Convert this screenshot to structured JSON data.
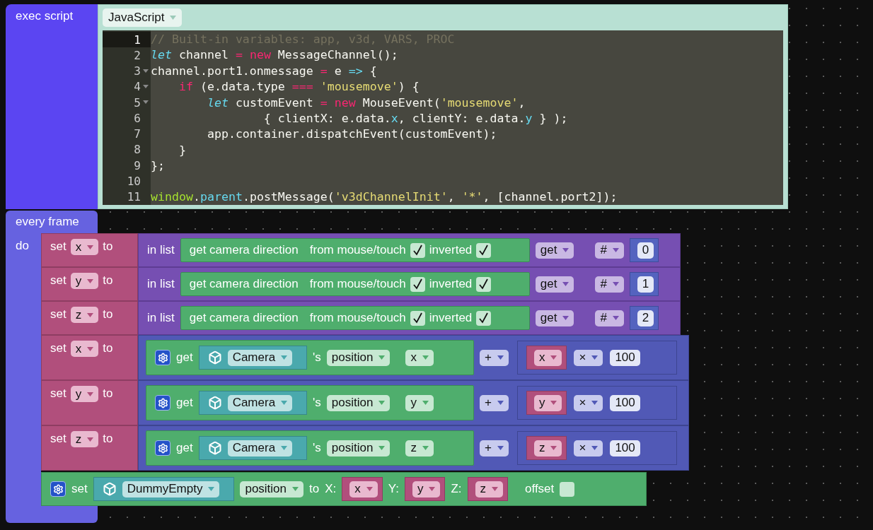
{
  "exec_block": {
    "label": "exec script",
    "language": "JavaScript",
    "code_lines": [
      {
        "number": "1",
        "active": true,
        "fold": false,
        "tokens": [
          {
            "kind": "comment",
            "text": "// Built-in variables: app, v3d, VARS, PROC"
          }
        ]
      },
      {
        "number": "2",
        "active": false,
        "fold": false,
        "tokens": [
          {
            "kind": "storage",
            "text": "let"
          },
          {
            "kind": "plain",
            "text": " channel "
          },
          {
            "kind": "operator",
            "text": "="
          },
          {
            "kind": "operator",
            "text": " new"
          },
          {
            "kind": "plain",
            "text": " MessageChannel();"
          }
        ]
      },
      {
        "number": "3",
        "active": false,
        "fold": true,
        "tokens": [
          {
            "kind": "plain",
            "text": "channel.port1.onmessage "
          },
          {
            "kind": "operator",
            "text": "="
          },
          {
            "kind": "plain",
            "text": " e "
          },
          {
            "kind": "property",
            "text": "=>"
          },
          {
            "kind": "plain",
            "text": " {"
          }
        ]
      },
      {
        "number": "4",
        "active": false,
        "fold": true,
        "tokens": [
          {
            "kind": "operator",
            "text": "    if"
          },
          {
            "kind": "plain",
            "text": " (e.data.type "
          },
          {
            "kind": "operator",
            "text": "==="
          },
          {
            "kind": "string",
            "text": " 'mousemove'"
          },
          {
            "kind": "plain",
            "text": ") {"
          }
        ]
      },
      {
        "number": "5",
        "active": false,
        "fold": true,
        "tokens": [
          {
            "kind": "storage",
            "text": "        let"
          },
          {
            "kind": "plain",
            "text": " customEvent "
          },
          {
            "kind": "operator",
            "text": "="
          },
          {
            "kind": "operator",
            "text": " new"
          },
          {
            "kind": "plain",
            "text": " MouseEvent("
          },
          {
            "kind": "string",
            "text": "'mousemove'"
          },
          {
            "kind": "plain",
            "text": ","
          }
        ]
      },
      {
        "number": "6",
        "active": false,
        "fold": false,
        "tokens": [
          {
            "kind": "plain",
            "text": "                { clientX: e.data."
          },
          {
            "kind": "property",
            "text": "x"
          },
          {
            "kind": "plain",
            "text": ", clientY: e.data."
          },
          {
            "kind": "property",
            "text": "y"
          },
          {
            "kind": "plain",
            "text": " } );"
          }
        ]
      },
      {
        "number": "7",
        "active": false,
        "fold": false,
        "tokens": [
          {
            "kind": "plain",
            "text": "        app.container.dispatchEvent(customEvent);"
          }
        ]
      },
      {
        "number": "8",
        "active": false,
        "fold": false,
        "tokens": [
          {
            "kind": "plain",
            "text": "    }"
          }
        ]
      },
      {
        "number": "9",
        "active": false,
        "fold": false,
        "tokens": [
          {
            "kind": "plain",
            "text": "};"
          }
        ]
      },
      {
        "number": "10",
        "active": false,
        "fold": false
      },
      {
        "number": "11",
        "active": false,
        "fold": false,
        "tokens": [
          {
            "kind": "global",
            "text": "window"
          },
          {
            "kind": "plain",
            "text": "."
          },
          {
            "kind": "property",
            "text": "parent"
          },
          {
            "kind": "plain",
            "text": ".postMessage("
          },
          {
            "kind": "string",
            "text": "'v3dChannelInit'"
          },
          {
            "kind": "plain",
            "text": ", "
          },
          {
            "kind": "string",
            "text": "'*'"
          },
          {
            "kind": "plain",
            "text": ", [channel.port2]);"
          }
        ]
      }
    ]
  },
  "every_frame": {
    "label": "every frame",
    "do_label": "do",
    "statements": [
      {
        "kind": "set_list",
        "set_label": "set",
        "variable": "x",
        "to_label": "to",
        "in_list_label": "in list",
        "getter": "get camera direction",
        "from_label": "from mouse/touch",
        "from_checked": true,
        "inverted_label": "inverted",
        "inverted_checked": true,
        "mode": "get",
        "index_mode": "#",
        "index": "0"
      },
      {
        "kind": "set_list",
        "set_label": "set",
        "variable": "y",
        "to_label": "to",
        "in_list_label": "in list",
        "getter": "get camera direction",
        "from_label": "from mouse/touch",
        "from_checked": true,
        "inverted_label": "inverted",
        "inverted_checked": true,
        "mode": "get",
        "index_mode": "#",
        "index": "1"
      },
      {
        "kind": "set_list",
        "set_label": "set",
        "variable": "z",
        "to_label": "to",
        "in_list_label": "in list",
        "getter": "get camera direction",
        "from_label": "from mouse/touch",
        "from_checked": true,
        "inverted_label": "inverted",
        "inverted_checked": true,
        "mode": "get",
        "index_mode": "#",
        "index": "2"
      },
      {
        "kind": "set_math",
        "set_label": "set",
        "variable": "x",
        "to_label": "to",
        "get_label": "get",
        "object": "Camera",
        "of_label": "'s",
        "property": "position",
        "axis": "x",
        "operator": "+",
        "operand_variable": "x",
        "multiply": "×",
        "factor": "100"
      },
      {
        "kind": "set_math",
        "set_label": "set",
        "variable": "y",
        "to_label": "to",
        "get_label": "get",
        "object": "Camera",
        "of_label": "'s",
        "property": "position",
        "axis": "y",
        "operator": "+",
        "operand_variable": "y",
        "multiply": "×",
        "factor": "100"
      },
      {
        "kind": "set_math",
        "set_label": "set",
        "variable": "z",
        "to_label": "to",
        "get_label": "get",
        "object": "Camera",
        "of_label": "'s",
        "property": "position",
        "axis": "z",
        "operator": "+",
        "operand_variable": "z",
        "multiply": "×",
        "factor": "100"
      },
      {
        "kind": "set_object",
        "set_label": "set",
        "object": "DummyEmpty",
        "property": "position",
        "to_label": "to",
        "x_label": "X:",
        "x": "x",
        "y_label": "Y:",
        "y": "y",
        "z_label": "Z:",
        "z": "z",
        "offset_label": "offset",
        "offset_checked": false
      }
    ]
  }
}
